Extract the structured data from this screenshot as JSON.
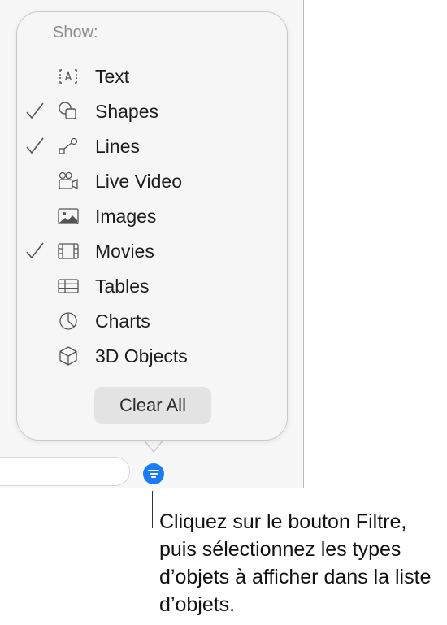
{
  "popover": {
    "header": "Show:",
    "items": [
      {
        "label": "Text",
        "checked": false,
        "icon": "text-box-icon"
      },
      {
        "label": "Shapes",
        "checked": true,
        "icon": "shapes-icon"
      },
      {
        "label": "Lines",
        "checked": true,
        "icon": "lines-icon"
      },
      {
        "label": "Live Video",
        "checked": false,
        "icon": "video-camera-icon"
      },
      {
        "label": "Images",
        "checked": false,
        "icon": "image-icon"
      },
      {
        "label": "Movies",
        "checked": true,
        "icon": "film-icon"
      },
      {
        "label": "Tables",
        "checked": false,
        "icon": "table-icon"
      },
      {
        "label": "Charts",
        "checked": false,
        "icon": "pie-chart-icon"
      },
      {
        "label": "3D Objects",
        "checked": false,
        "icon": "cube-icon"
      }
    ],
    "clear_all_label": "Clear All"
  },
  "callout": {
    "text": "Cliquez sur le bouton Filtre, puis sélectionnez les types d’objets à afficher dans la liste d’objets."
  },
  "colors": {
    "accent": "#1a7cf6",
    "popover_bg": "#f6f6f6",
    "header_text": "#8e8e8e"
  }
}
